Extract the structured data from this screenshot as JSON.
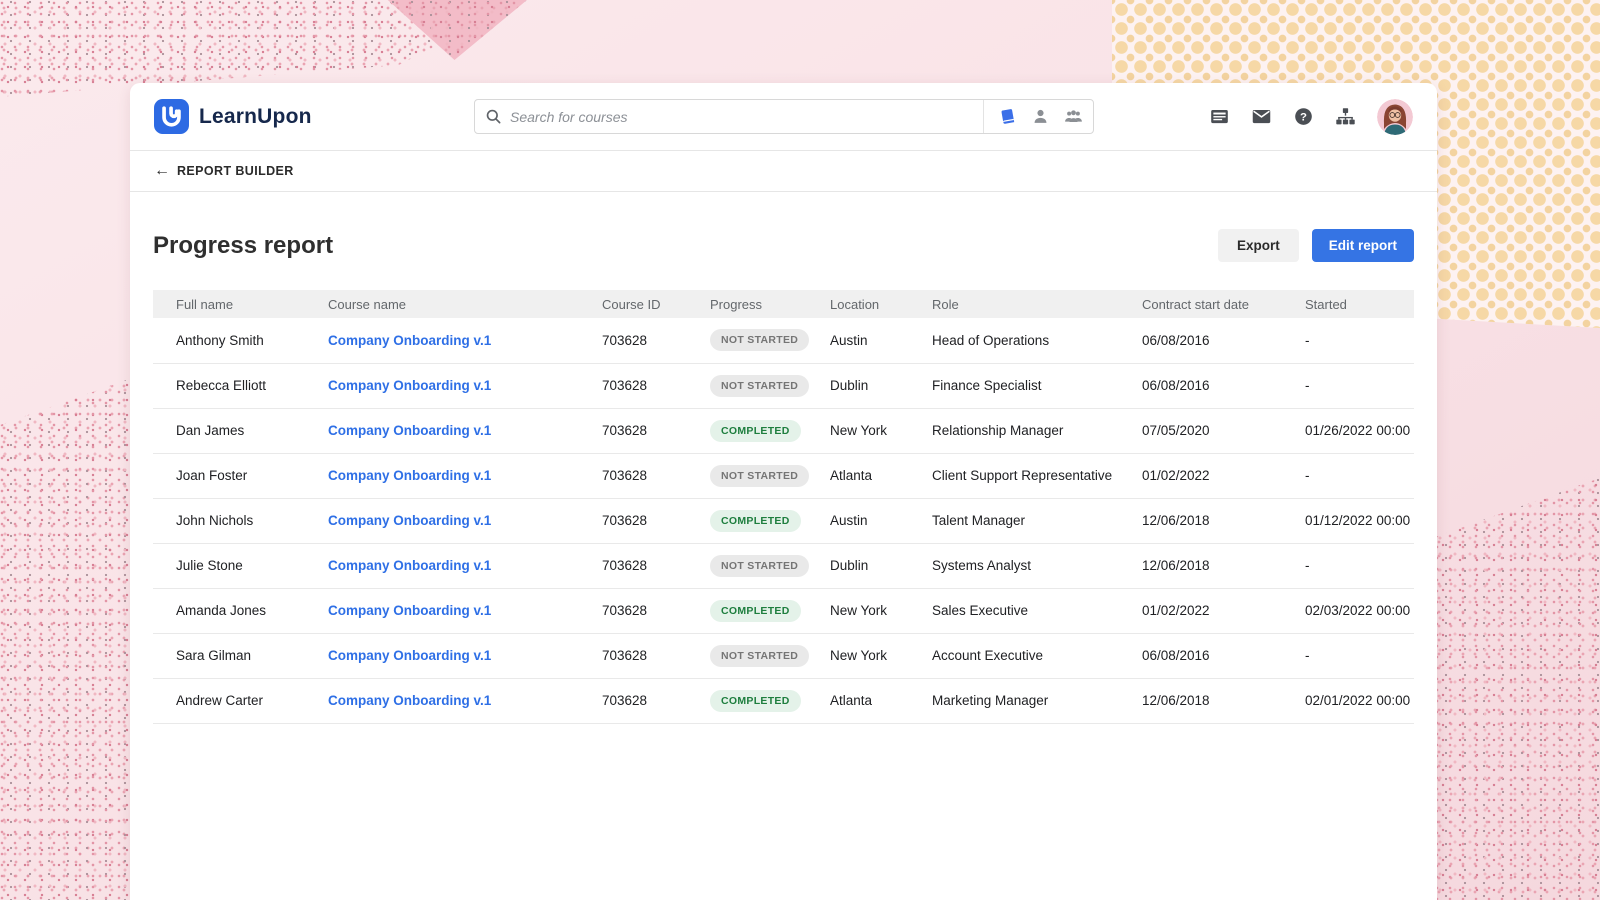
{
  "brand": {
    "name": "LearnUpon"
  },
  "search": {
    "placeholder": "Search for courses",
    "filters": [
      "book-icon",
      "user-icon",
      "group-icon"
    ]
  },
  "topnav": {
    "icons": [
      "card-icon",
      "mail-icon",
      "help-icon",
      "sitemap-icon",
      "avatar"
    ]
  },
  "breadcrumb": {
    "back": "←",
    "label": "REPORT BUILDER"
  },
  "page": {
    "title": "Progress report",
    "export_label": "Export",
    "edit_label": "Edit report"
  },
  "colors": {
    "accent_blue": "#3574e4",
    "link_blue": "#2e6fe6",
    "completed_green": "#1e7e3e",
    "completed_bg": "#e4f2e9",
    "notstarted_gray": "#757575",
    "notstarted_bg": "#e9e9e9",
    "logo_blue": "#2d6ae3"
  },
  "table": {
    "columns": [
      "Full name",
      "Course name",
      "Course ID",
      "Progress",
      "Location",
      "Role",
      "Contract start date",
      "Started"
    ],
    "rows": [
      {
        "full_name": "Anthony Smith",
        "course_name": "Company Onboarding v.1",
        "course_id": "703628",
        "progress": "NOT STARTED",
        "location": "Austin",
        "role": "Head of Operations",
        "contract_start": "06/08/2016",
        "started": "-"
      },
      {
        "full_name": "Rebecca Elliott",
        "course_name": "Company Onboarding v.1",
        "course_id": "703628",
        "progress": "NOT STARTED",
        "location": "Dublin",
        "role": "Finance Specialist",
        "contract_start": "06/08/2016",
        "started": "-"
      },
      {
        "full_name": "Dan James",
        "course_name": "Company Onboarding v.1",
        "course_id": "703628",
        "progress": "COMPLETED",
        "location": "New York",
        "role": "Relationship Manager",
        "contract_start": "07/05/2020",
        "started": "01/26/2022 00:00"
      },
      {
        "full_name": "Joan Foster",
        "course_name": "Company Onboarding v.1",
        "course_id": "703628",
        "progress": "NOT STARTED",
        "location": "Atlanta",
        "role": "Client Support Representative",
        "contract_start": "01/02/2022",
        "started": "-"
      },
      {
        "full_name": "John Nichols",
        "course_name": "Company Onboarding v.1",
        "course_id": "703628",
        "progress": "COMPLETED",
        "location": "Austin",
        "role": "Talent Manager",
        "contract_start": "12/06/2018",
        "started": "01/12/2022 00:00"
      },
      {
        "full_name": "Julie Stone",
        "course_name": "Company Onboarding v.1",
        "course_id": "703628",
        "progress": "NOT STARTED",
        "location": "Dublin",
        "role": "Systems Analyst",
        "contract_start": "12/06/2018",
        "started": "-"
      },
      {
        "full_name": "Amanda Jones",
        "course_name": "Company Onboarding v.1",
        "course_id": "703628",
        "progress": "COMPLETED",
        "location": "New York",
        "role": "Sales Executive",
        "contract_start": "01/02/2022",
        "started": "02/03/2022 00:00"
      },
      {
        "full_name": "Sara Gilman",
        "course_name": "Company Onboarding v.1",
        "course_id": "703628",
        "progress": "NOT STARTED",
        "location": "New York",
        "role": "Account Executive",
        "contract_start": "06/08/2016",
        "started": "-"
      },
      {
        "full_name": "Andrew Carter",
        "course_name": "Company Onboarding v.1",
        "course_id": "703628",
        "progress": "COMPLETED",
        "location": "Atlanta",
        "role": "Marketing Manager",
        "contract_start": "12/06/2018",
        "started": "02/01/2022 00:00"
      }
    ]
  }
}
